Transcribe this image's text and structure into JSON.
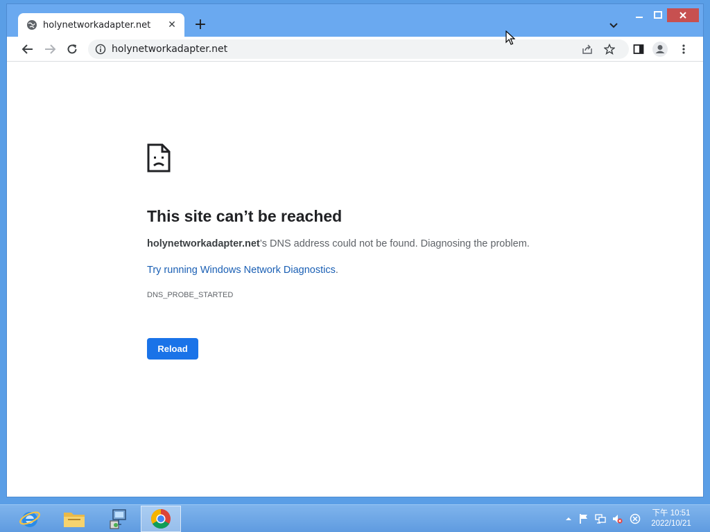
{
  "browser": {
    "tab": {
      "title": "holynetworkadapter.net",
      "close": "✕"
    },
    "new_tab": "+",
    "address": "holynetworkadapter.net"
  },
  "error_page": {
    "title": "This site can’t be reached",
    "host": "holynetworkadapter.net",
    "description_suffix": "’s DNS address could not be found. Diagnosing the problem.",
    "diagnostics_link": "Try running Windows Network Diagnostics",
    "diagnostics_suffix": ".",
    "error_code": "DNS_PROBE_STARTED",
    "reload_label": "Reload"
  },
  "taskbar": {
    "pinned": [
      "internet-explorer",
      "file-explorer",
      "network-tool",
      "chrome"
    ],
    "clock": {
      "time": "下午 10:51",
      "date": "2022/10/21"
    }
  },
  "colors": {
    "accent": "#1a73e8",
    "link": "#1a5fb4",
    "window_frame": "#6aa9f0",
    "close_button": "#c75050"
  },
  "icons": {
    "tab_favicon": "globe-icon",
    "error": "sad-document-icon",
    "info": "info-icon"
  }
}
